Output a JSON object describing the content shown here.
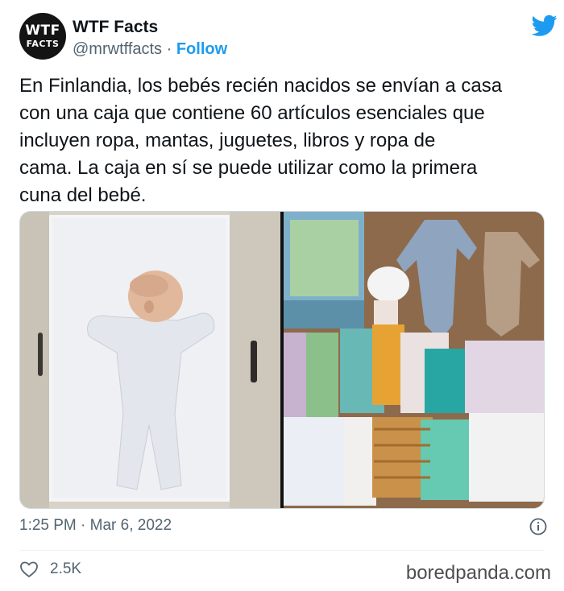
{
  "author": {
    "avatar_line1": "WTF",
    "avatar_line2": "FACTS",
    "name": "WTF Facts",
    "handle": "@mrwtffacts",
    "separator": " · ",
    "follow_label": "Follow"
  },
  "tweet": {
    "lines": [
      "En Finlandia, los bebés recién nacidos se envían a casa",
      "con una caja que contiene 60 artículos esenciales que",
      "incluyen ropa, mantas, juguetes, libros y ropa de",
      "cama. La caja en sí se puede utilizar como la primera",
      "cuna del bebé."
    ]
  },
  "meta": {
    "timestamp": "1:25 PM · Mar 6, 2022"
  },
  "engagement": {
    "likes": "2.5K"
  },
  "watermark": "boredpanda.com",
  "icons": {
    "brand": "twitter-bird-icon",
    "info": "info-icon",
    "like": "heart-icon"
  },
  "colors": {
    "link": "#1d9bf0",
    "muted": "#536471",
    "text": "#0f1419"
  }
}
